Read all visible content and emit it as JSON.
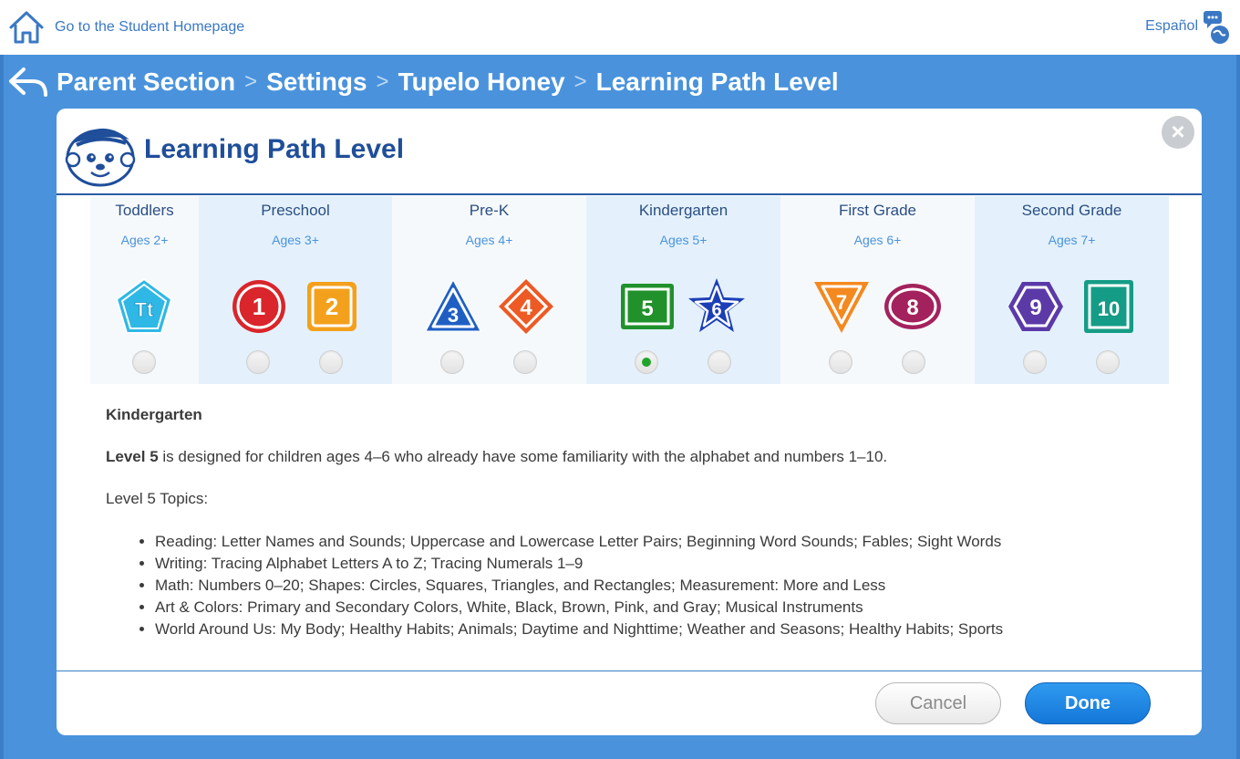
{
  "topbar": {
    "home_label": "Go to the Student Homepage",
    "language_label": "Español"
  },
  "breadcrumb": [
    "Parent Section",
    "Settings",
    "Tupelo Honey",
    "Learning Path Level"
  ],
  "breadcrumb_separator": ">",
  "modal": {
    "title": "Learning Path Level",
    "close_label": "×"
  },
  "groups": [
    {
      "name": "Toddlers",
      "ages": "Ages 2+"
    },
    {
      "name": "Preschool",
      "ages": "Ages 3+"
    },
    {
      "name": "Pre-K",
      "ages": "Ages 4+"
    },
    {
      "name": "Kindergarten",
      "ages": "Ages 5+"
    },
    {
      "name": "First Grade",
      "ages": "Ages 6+"
    },
    {
      "name": "Second Grade",
      "ages": "Ages 7+"
    }
  ],
  "levels": [
    {
      "label": "Tt",
      "shape": "pentagon",
      "color": "#2fb8e6",
      "selected": false
    },
    {
      "label": "1",
      "shape": "circle",
      "color": "#d9252b",
      "selected": false
    },
    {
      "label": "2",
      "shape": "rounded-square",
      "color": "#f3a11c",
      "selected": false
    },
    {
      "label": "3",
      "shape": "triangle",
      "color": "#1f5fc4",
      "selected": false
    },
    {
      "label": "4",
      "shape": "diamond",
      "color": "#ee5a24",
      "selected": false
    },
    {
      "label": "5",
      "shape": "square",
      "color": "#21912c",
      "selected": true
    },
    {
      "label": "6",
      "shape": "star",
      "color": "#1c3fb8",
      "selected": false
    },
    {
      "label": "7",
      "shape": "inverted-triangle",
      "color": "#f4891f",
      "selected": false
    },
    {
      "label": "8",
      "shape": "oval",
      "color": "#a3225d",
      "selected": false
    },
    {
      "label": "9",
      "shape": "hexagon",
      "color": "#5b3aa8",
      "selected": false
    },
    {
      "label": "10",
      "shape": "rectangle",
      "color": "#159c86",
      "selected": false
    }
  ],
  "description": {
    "title": "Kindergarten",
    "level_bold": "Level 5",
    "level_text": " is designed for children ages 4–6 who already have some familiarity with the alphabet and numbers 1–10.",
    "topics_label": "Level 5 Topics:",
    "topics": [
      "Reading: Letter Names and Sounds; Uppercase and Lowercase Letter Pairs; Beginning Word Sounds; Fables; Sight Words",
      "Writing: Tracing Alphabet Letters A to Z; Tracing Numerals 1–9",
      "Math: Numbers 0–20; Shapes: Circles, Squares, Triangles, and Rectangles; Measurement: More and Less",
      "Art & Colors: Primary and Secondary Colors, White, Black, Brown, Pink, and Gray; Musical Instruments",
      "World Around Us: My Body; Healthy Habits; Animals; Daytime and Nighttime; Weather and Seasons; Healthy Habits; Sports"
    ]
  },
  "buttons": {
    "cancel": "Cancel",
    "done": "Done"
  }
}
